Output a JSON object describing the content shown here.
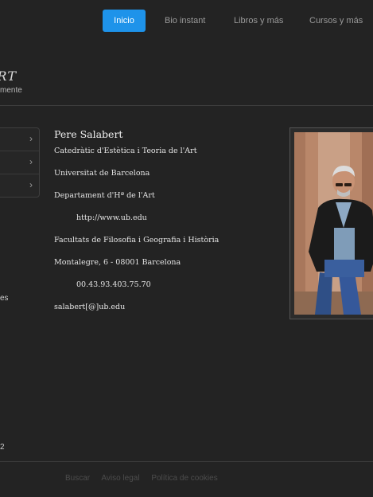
{
  "nav": {
    "items": [
      {
        "label": "Inicio",
        "active": true
      },
      {
        "label": "Bio instant",
        "active": false
      },
      {
        "label": "Libros y más",
        "active": false
      },
      {
        "label": "Cursos y más",
        "active": false
      }
    ]
  },
  "header": {
    "logo_text": "ART",
    "tagline": "mente"
  },
  "sidebar": {
    "fragment_label": "es",
    "year_fragment": "2"
  },
  "profile": {
    "name": "Pere Salabert",
    "title": "Catedràtic d'Estètica i Teoria de l'Art",
    "university": "Universitat de Barcelona",
    "department": "Departament d'Hª de l'Art",
    "website": "http://www.ub.edu",
    "faculty": "Facultats de Filosofia i Geografia i Història",
    "address": "Montalegre, 6 - 08001 Barcelona",
    "phone": "00.43.93.403.75.70",
    "email": "salabert[@]ub.edu"
  },
  "footer": {
    "links": [
      "Buscar",
      "Aviso legal",
      "Política de cookies"
    ]
  },
  "colors": {
    "background": "#232323",
    "accent": "#1e93ea"
  }
}
